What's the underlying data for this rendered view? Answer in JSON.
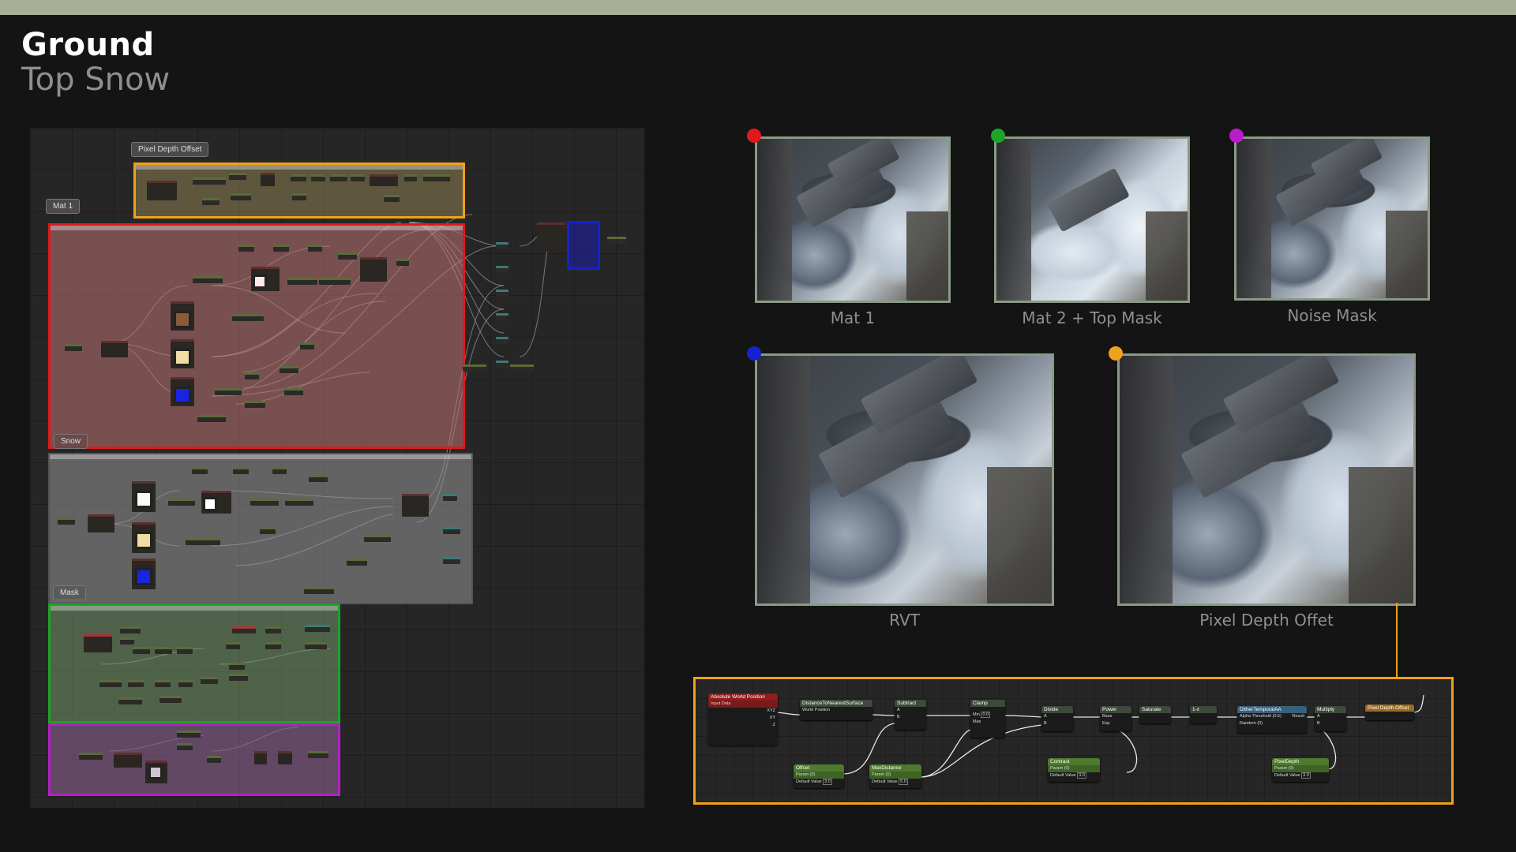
{
  "header": {
    "title": "Ground",
    "subtitle": "Top Snow"
  },
  "graph": {
    "tags": {
      "pixel_depth_offset": "Pixel Depth Offset",
      "mat1": "Mat 1",
      "snow": "Snow",
      "mask": "Mask"
    }
  },
  "previews": [
    {
      "label": "Mat 1",
      "dot_color": "#e0191b"
    },
    {
      "label": "Mat 2 + Top Mask",
      "dot_color": "#1ea427"
    },
    {
      "label": "Noise Mask",
      "dot_color": "#b71ec9"
    },
    {
      "label": "RVT",
      "dot_color": "#1522d0"
    },
    {
      "label": "Pixel Depth Offet",
      "dot_color": "#f0a21a"
    }
  ],
  "nodes": {
    "absolute_world_position": {
      "title": "Absolute World Position",
      "sub": "Input Data",
      "pins": [
        "XYZ",
        "XY",
        "Z"
      ]
    },
    "distance_to_nearest_surface": {
      "title": "DistanceToNearestSurface",
      "pin": "World Position"
    },
    "subtract": {
      "title": "Subtract",
      "pins": [
        "A",
        "B"
      ]
    },
    "clamp": {
      "title": "Clamp",
      "pins": [
        "Min",
        "Max"
      ],
      "min_value": "0.0"
    },
    "divide": {
      "title": "Divide",
      "pins": [
        "A",
        "B"
      ]
    },
    "power": {
      "title": "Power",
      "pins": [
        "Base",
        "Exp"
      ]
    },
    "saturate": {
      "title": "Saturate"
    },
    "one_minus": {
      "title": "1-x"
    },
    "dither": {
      "title": "DitherTemporalAA",
      "pins": [
        "Alpha Threshold (0.5)",
        "Random (0)"
      ],
      "out": "Result"
    },
    "multiply": {
      "title": "Multiply",
      "pins": [
        "A",
        "B"
      ]
    },
    "pixel_depth_offset": {
      "title": "Pixel Depth Offset"
    },
    "offset": {
      "title": "Offset",
      "sub": "Param (0)",
      "default_label": "Default Value",
      "default_value": "3.0"
    },
    "max_distance": {
      "title": "MaxDistance",
      "sub": "Param (0)",
      "default_label": "Default Value",
      "default_value": "5.0"
    },
    "contrast": {
      "title": "Contrast",
      "sub": "Param (0)",
      "default_label": "Default Value",
      "default_value": "3.0"
    },
    "pixel_depth": {
      "title": "PixelDepth",
      "sub": "Param (0)",
      "default_label": "Default Value",
      "default_value": "3.0"
    }
  },
  "colors": {
    "orange": "#f0a21a",
    "red": "#e0191b",
    "green": "#1ea427",
    "purple": "#b71ec9",
    "blue": "#1522d0",
    "topbar": "#a8af96"
  }
}
